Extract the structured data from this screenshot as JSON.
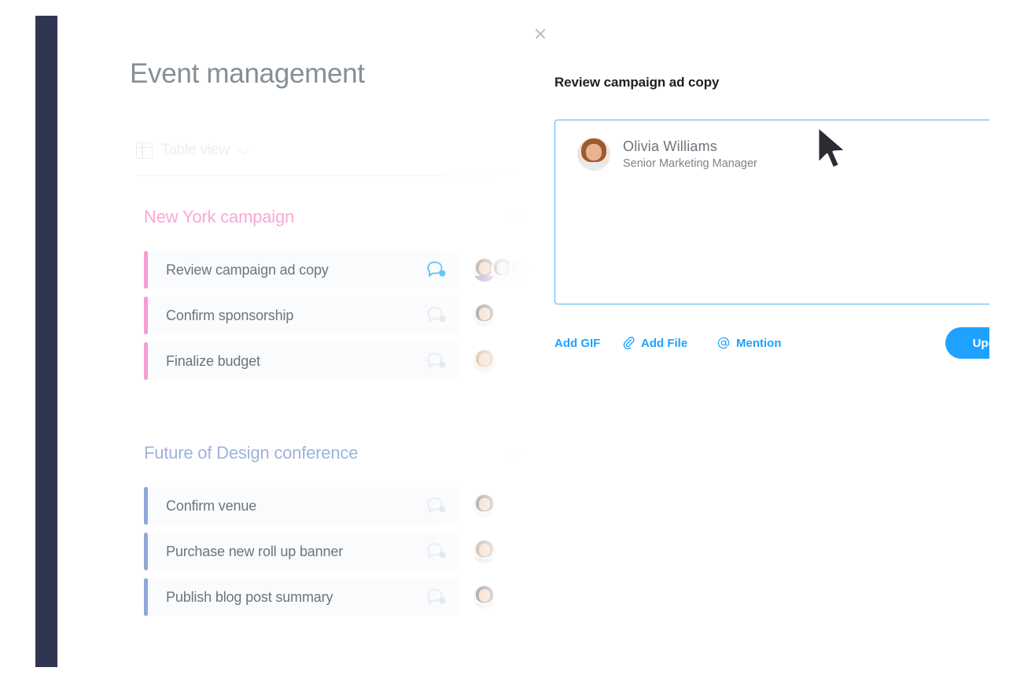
{
  "board": {
    "title": "Event management",
    "view_switcher": {
      "label": "Table view",
      "grid_icon": "table-grid-icon",
      "chevron_icon": "chevron-down-icon"
    },
    "owner_column_label": "Owner",
    "groups": [
      {
        "name": "New York campaign",
        "accent_color": "#f79bd3",
        "title_color": "#f9a8d9",
        "tasks": [
          {
            "label": "Review campaign ad copy",
            "comment_icon": "comment-bubble-icon",
            "comment_active": true,
            "owners": 3
          },
          {
            "label": "Confirm sponsorship",
            "comment_icon": "comment-bubble-icon",
            "comment_active": false,
            "owners": 1
          },
          {
            "label": "Finalize budget",
            "comment_icon": "comment-bubble-icon",
            "comment_active": false,
            "owners": 1
          }
        ]
      },
      {
        "name": "Future of Design conference",
        "accent_color": "#8fa8d8",
        "title_color": "#9db2dd",
        "tasks": [
          {
            "label": "Confirm venue",
            "comment_icon": "comment-bubble-icon",
            "comment_active": false,
            "owners": 1
          },
          {
            "label": "Purchase new roll up banner",
            "comment_icon": "comment-bubble-icon",
            "comment_active": false,
            "owners": 1
          },
          {
            "label": "Publish blog post summary",
            "comment_icon": "comment-bubble-icon",
            "comment_active": false,
            "owners": 1
          }
        ]
      }
    ]
  },
  "detail_panel": {
    "close_icon": "close-icon",
    "title": "Review campaign ad copy",
    "comment_box": {
      "mention": {
        "name": "Olivia  Williams",
        "role": "Senior Marketing Manager",
        "avatar": "user-avatar"
      }
    },
    "actions": {
      "add_gif": "Add GIF",
      "add_file": "Add File",
      "add_file_icon": "paperclip-icon",
      "mention": "Mention",
      "mention_icon": "at-sign-icon",
      "update": "Update"
    }
  },
  "colors": {
    "accent_blue": "#1FA2FF",
    "border_blue": "#4fb3f4",
    "nav_rail": "#303652",
    "pink_accent": "#f79bd3",
    "blue_accent": "#8fa8d8",
    "row_bg": "#fafbfc"
  },
  "cursor": {
    "icon": "mouse-pointer-icon"
  }
}
